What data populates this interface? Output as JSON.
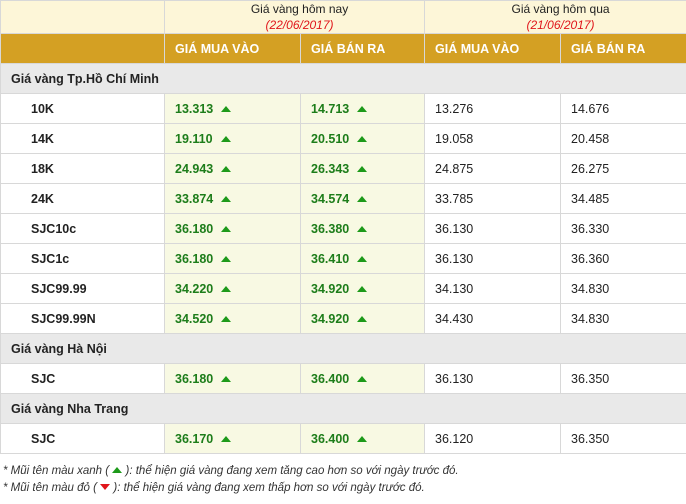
{
  "header": {
    "today_label": "Giá vàng hôm nay",
    "today_date": "(22/06/2017)",
    "yesterday_label": "Giá vàng hôm qua",
    "yesterday_date": "(21/06/2017)",
    "col_buy": "GIÁ MUA VÀO",
    "col_sell": "GIÁ BÁN RA"
  },
  "groups": [
    {
      "name": "Giá vàng Tp.Hồ Chí Minh",
      "rows": [
        {
          "name": "10K",
          "today_buy": "13.313",
          "today_sell": "14.713",
          "yest_buy": "13.276",
          "yest_sell": "14.676"
        },
        {
          "name": "14K",
          "today_buy": "19.110",
          "today_sell": "20.510",
          "yest_buy": "19.058",
          "yest_sell": "20.458"
        },
        {
          "name": "18K",
          "today_buy": "24.943",
          "today_sell": "26.343",
          "yest_buy": "24.875",
          "yest_sell": "26.275"
        },
        {
          "name": "24K",
          "today_buy": "33.874",
          "today_sell": "34.574",
          "yest_buy": "33.785",
          "yest_sell": "34.485"
        },
        {
          "name": "SJC10c",
          "today_buy": "36.180",
          "today_sell": "36.380",
          "yest_buy": "36.130",
          "yest_sell": "36.330"
        },
        {
          "name": "SJC1c",
          "today_buy": "36.180",
          "today_sell": "36.410",
          "yest_buy": "36.130",
          "yest_sell": "36.360"
        },
        {
          "name": "SJC99.99",
          "today_buy": "34.220",
          "today_sell": "34.920",
          "yest_buy": "34.130",
          "yest_sell": "34.830"
        },
        {
          "name": "SJC99.99N",
          "today_buy": "34.520",
          "today_sell": "34.920",
          "yest_buy": "34.430",
          "yest_sell": "34.830"
        }
      ]
    },
    {
      "name": "Giá vàng Hà Nội",
      "rows": [
        {
          "name": "SJC",
          "today_buy": "36.180",
          "today_sell": "36.400",
          "yest_buy": "36.130",
          "yest_sell": "36.350"
        }
      ]
    },
    {
      "name": "Giá vàng Nha Trang",
      "rows": [
        {
          "name": "SJC",
          "today_buy": "36.170",
          "today_sell": "36.400",
          "yest_buy": "36.120",
          "yest_sell": "36.350"
        }
      ]
    }
  ],
  "notes": {
    "green_prefix": "* Mũi tên màu xanh (",
    "green_suffix": "): thể hiện giá vàng đang xem tăng cao hơn so với ngày trước đó.",
    "red_prefix": "* Mũi tên màu đỏ (",
    "red_suffix": "): thể hiện giá vàng đang xem thấp hơn so với ngày trước đó."
  },
  "colors": {
    "header_gold": "#d4a023",
    "up_green": "#1d9a1a",
    "down_red": "#e0161b"
  }
}
